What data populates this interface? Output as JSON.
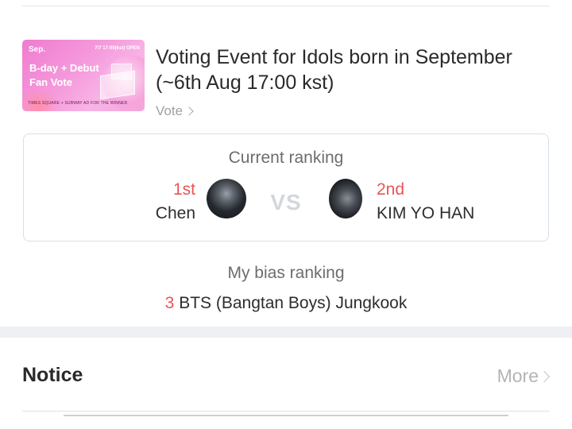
{
  "event": {
    "banner": {
      "month": "Sep.",
      "date_text": "7/7 17:00(kst) OPEN",
      "headline_1": "B-day + Debut",
      "headline_2": "Fan Vote",
      "footer": "TIMES SQUARE + SUBWAY AD FOR THE WINNER"
    },
    "title": "Voting Event for Idols born in September (~6th Aug 17:00 kst)",
    "vote_label": "Vote"
  },
  "current_ranking": {
    "title": "Current ranking",
    "vs_label": "VS",
    "first": {
      "position": "1st",
      "name": "Chen"
    },
    "second": {
      "position": "2nd",
      "name": "KIM YO HAN"
    }
  },
  "bias_ranking": {
    "title": "My bias ranking",
    "rank": "3",
    "name": "BTS (Bangtan Boys) Jungkook"
  },
  "notice": {
    "title": "Notice",
    "more_label": "More"
  },
  "colors": {
    "accent_red": "#ea5455",
    "banner_pink": "#f59bdc",
    "box_border": "#d7e0ea"
  }
}
